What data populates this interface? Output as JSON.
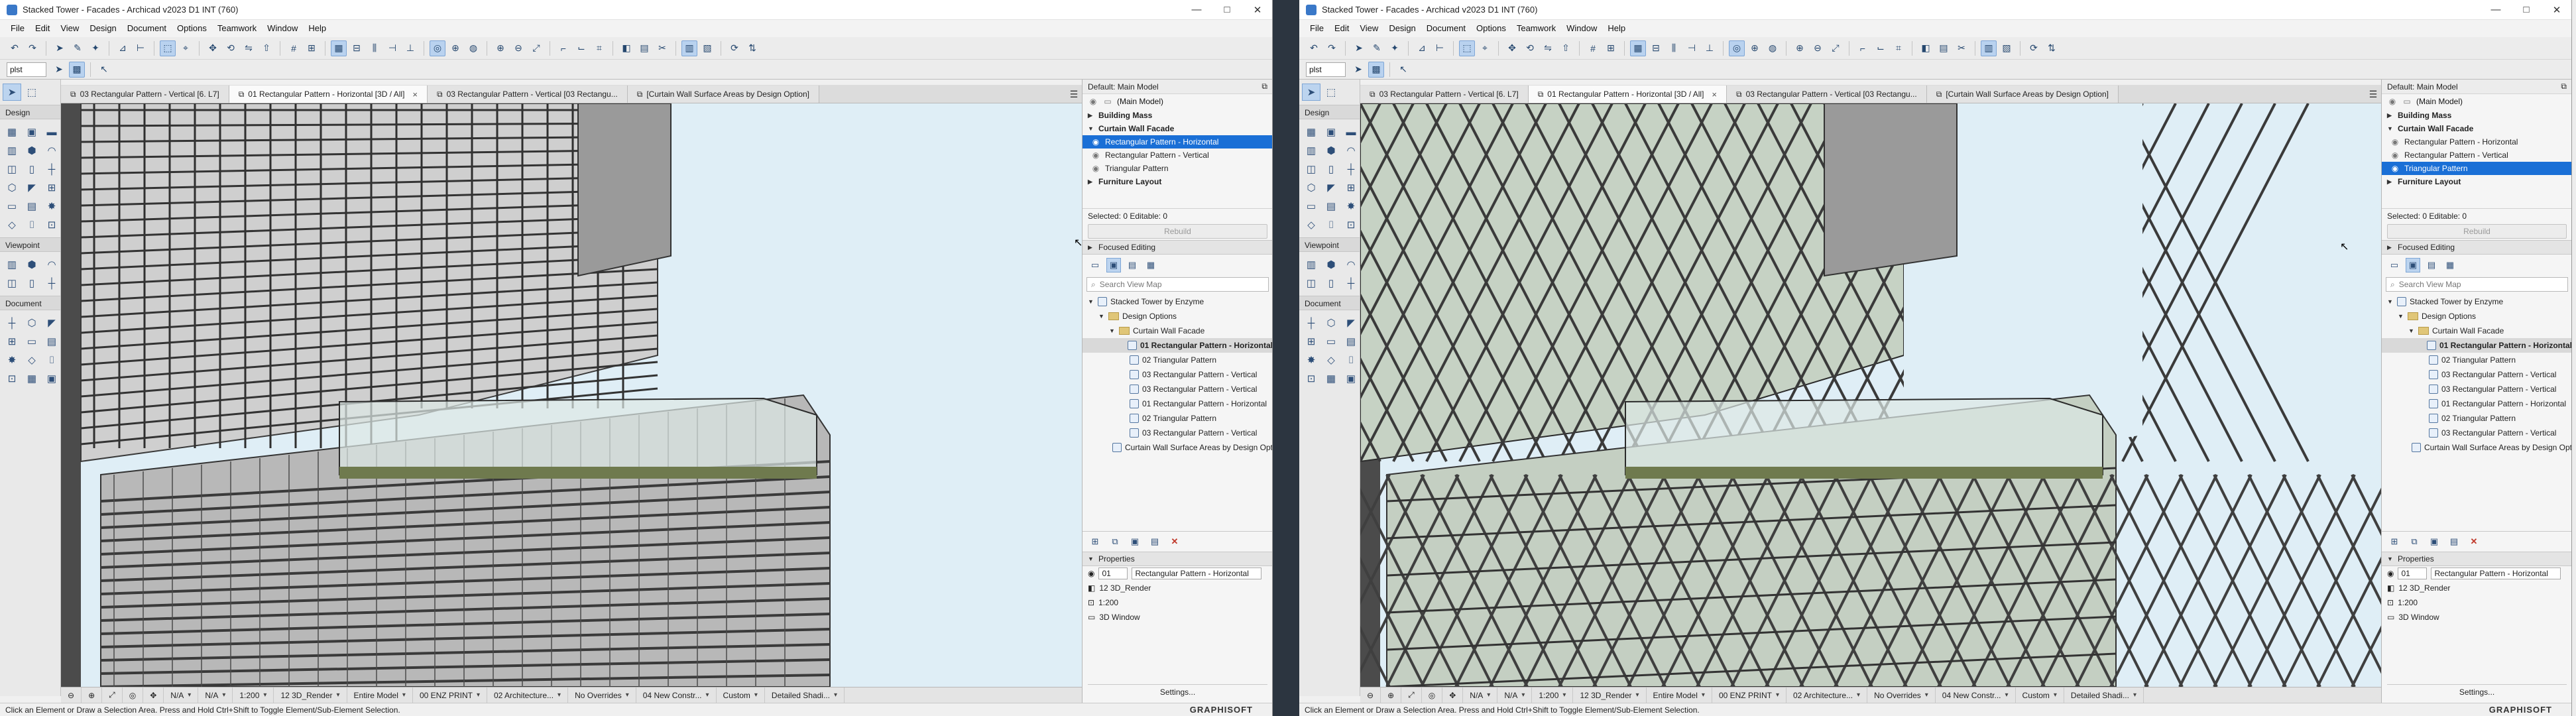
{
  "windows": [
    {
      "title": "Stacked Tower - Facades - Archicad v2023 D1 INT (760)",
      "menu": [
        "File",
        "Edit",
        "View",
        "Design",
        "Document",
        "Options",
        "Teamwork",
        "Window",
        "Help"
      ],
      "story": "plst",
      "tabs": [
        {
          "label": "03 Rectangular Pattern - Vertical [6. L7]",
          "active": false
        },
        {
          "label": "01 Rectangular Pattern - Horizontal [3D / All]",
          "active": true,
          "close": "×"
        },
        {
          "label": "03 Rectangular Pattern - Vertical [03 Rectangu...",
          "active": false
        },
        {
          "label": "[Curtain Wall Surface Areas by Design Option]",
          "active": false
        }
      ],
      "toolbox": {
        "design": "Design",
        "viewpoint": "Viewpoint",
        "document": "Document"
      },
      "navigator": {
        "default_label": "Default: Main Model",
        "main_model": "(Main Model)",
        "options": [
          {
            "label": "Building Mass",
            "type": "group"
          },
          {
            "label": "Curtain Wall Facade",
            "type": "group-open"
          },
          {
            "label": "Rectangular Pattern - Horizontal",
            "type": "item",
            "selected": true
          },
          {
            "label": "Rectangular Pattern - Vertical",
            "type": "item",
            "selected": false
          },
          {
            "label": "Triangular Pattern",
            "type": "item",
            "selected": false
          },
          {
            "label": "Furniture Layout",
            "type": "group"
          }
        ],
        "selected_info": "Selected: 0 Editable: 0",
        "rebuild": "Rebuild",
        "focused": "Focused Editing",
        "search_placeholder": "Search View Map",
        "tree": [
          {
            "label": "Stacked Tower by Enzyme",
            "level": 0,
            "kind": "root"
          },
          {
            "label": "Design Options",
            "level": 1,
            "kind": "folder"
          },
          {
            "label": "Curtain Wall Facade",
            "level": 2,
            "kind": "folder"
          },
          {
            "label": "01 Rectangular Pattern - Horizontal",
            "level": 3,
            "kind": "view",
            "selected": true
          },
          {
            "label": "02 Triangular Pattern",
            "level": 3,
            "kind": "view"
          },
          {
            "label": "03 Rectangular Pattern - Vertical",
            "level": 3,
            "kind": "view"
          },
          {
            "label": "03 Rectangular Pattern - Vertical",
            "level": 3,
            "kind": "view"
          },
          {
            "label": "01 Rectangular Pattern - Horizontal",
            "level": 3,
            "kind": "view"
          },
          {
            "label": "02 Triangular Pattern",
            "level": 3,
            "kind": "view"
          },
          {
            "label": "03 Rectangular Pattern - Vertical",
            "level": 3,
            "kind": "view"
          },
          {
            "label": "Curtain Wall Surface Areas by Design Option",
            "level": 2,
            "kind": "schedule"
          }
        ],
        "properties": "Properties",
        "prop_id": "01",
        "prop_name": "Rectangular Pattern - Horizontal",
        "prop_render": "12 3D_Render",
        "prop_scale": "1:200",
        "prop_window": "3D Window",
        "settings": "Settings..."
      },
      "viewbar": [
        "N/A",
        "N/A",
        "1:200",
        "12 3D_Render",
        "Entire Model",
        "00 ENZ PRINT",
        "02 Architecture...",
        "No Overrides",
        "04 New Constr...",
        "Custom",
        "Detailed Shadi..."
      ],
      "status": "Click an Element or Draw a Selection Area. Press and Hold Ctrl+Shift to Toggle Element/Sub-Element Selection.",
      "brand": "GRAPHISOFT",
      "pattern": "rect"
    },
    {
      "title": "Stacked Tower - Facades - Archicad v2023 D1 INT (760)",
      "menu": [
        "File",
        "Edit",
        "View",
        "Design",
        "Document",
        "Options",
        "Teamwork",
        "Window",
        "Help"
      ],
      "story": "plst",
      "tabs": [
        {
          "label": "03 Rectangular Pattern - Vertical [6. L7]",
          "active": false
        },
        {
          "label": "01 Rectangular Pattern - Horizontal [3D / All]",
          "active": true,
          "close": "×"
        },
        {
          "label": "03 Rectangular Pattern - Vertical [03 Rectangu...",
          "active": false
        },
        {
          "label": "[Curtain Wall Surface Areas by Design Option]",
          "active": false
        }
      ],
      "toolbox": {
        "design": "Design",
        "viewpoint": "Viewpoint",
        "document": "Document"
      },
      "navigator": {
        "default_label": "Default: Main Model",
        "main_model": "(Main Model)",
        "options": [
          {
            "label": "Building Mass",
            "type": "group"
          },
          {
            "label": "Curtain Wall Facade",
            "type": "group-open"
          },
          {
            "label": "Rectangular Pattern - Horizontal",
            "type": "item",
            "selected": false
          },
          {
            "label": "Rectangular Pattern - Vertical",
            "type": "item",
            "selected": false
          },
          {
            "label": "Triangular Pattern",
            "type": "item",
            "selected": true
          },
          {
            "label": "Furniture Layout",
            "type": "group"
          }
        ],
        "selected_info": "Selected: 0 Editable: 0",
        "rebuild": "Rebuild",
        "focused": "Focused Editing",
        "search_placeholder": "Search View Map",
        "tree": [
          {
            "label": "Stacked Tower by Enzyme",
            "level": 0,
            "kind": "root"
          },
          {
            "label": "Design Options",
            "level": 1,
            "kind": "folder"
          },
          {
            "label": "Curtain Wall Facade",
            "level": 2,
            "kind": "folder"
          },
          {
            "label": "01 Rectangular Pattern - Horizontal",
            "level": 3,
            "kind": "view",
            "selected": true
          },
          {
            "label": "02 Triangular Pattern",
            "level": 3,
            "kind": "view"
          },
          {
            "label": "03 Rectangular Pattern - Vertical",
            "level": 3,
            "kind": "view"
          },
          {
            "label": "03 Rectangular Pattern - Vertical",
            "level": 3,
            "kind": "view"
          },
          {
            "label": "01 Rectangular Pattern - Horizontal",
            "level": 3,
            "kind": "view"
          },
          {
            "label": "02 Triangular Pattern",
            "level": 3,
            "kind": "view"
          },
          {
            "label": "03 Rectangular Pattern - Vertical",
            "level": 3,
            "kind": "view"
          },
          {
            "label": "Curtain Wall Surface Areas by Design Option",
            "level": 2,
            "kind": "schedule"
          }
        ],
        "properties": "Properties",
        "prop_id": "01",
        "prop_name": "Rectangular Pattern - Horizontal",
        "prop_render": "12 3D_Render",
        "prop_scale": "1:200",
        "prop_window": "3D Window",
        "settings": "Settings..."
      },
      "viewbar": [
        "N/A",
        "N/A",
        "1:200",
        "12 3D_Render",
        "Entire Model",
        "00 ENZ PRINT",
        "02 Architecture...",
        "No Overrides",
        "04 New Constr...",
        "Custom",
        "Detailed Shadi..."
      ],
      "status": "Click an Element or Draw a Selection Area. Press and Hold Ctrl+Shift to Toggle Element/Sub-Element Selection.",
      "brand": "GRAPHISOFT",
      "pattern": "tri"
    }
  ],
  "icons": {
    "minimize": "minimize-icon",
    "maximize": "maximize-icon",
    "close": "close-icon"
  }
}
